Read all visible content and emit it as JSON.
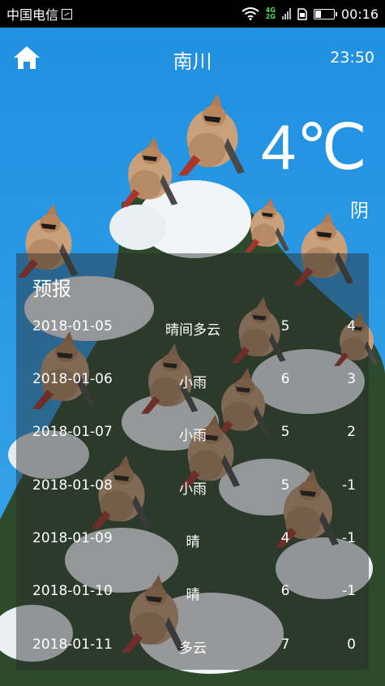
{
  "status_bar": {
    "carrier": "中国电信",
    "network_top": "4G",
    "network_bottom": "2G",
    "time": "00:16"
  },
  "header": {
    "city": "南川",
    "update_time": "23:50",
    "home_icon": "home-icon"
  },
  "current": {
    "temperature": "4℃",
    "condition": "阴"
  },
  "forecast": {
    "title": "预报",
    "days": [
      {
        "date": "2018-01-05",
        "weather": "晴间多云",
        "high": "5",
        "low": "4"
      },
      {
        "date": "2018-01-06",
        "weather": "小雨",
        "high": "6",
        "low": "3"
      },
      {
        "date": "2018-01-07",
        "weather": "小雨",
        "high": "5",
        "low": "2"
      },
      {
        "date": "2018-01-08",
        "weather": "小雨",
        "high": "5",
        "low": "-1"
      },
      {
        "date": "2018-01-09",
        "weather": "晴",
        "high": "4",
        "low": "-1"
      },
      {
        "date": "2018-01-10",
        "weather": "晴",
        "high": "6",
        "low": "-1"
      },
      {
        "date": "2018-01-11",
        "weather": "多云",
        "high": "7",
        "low": "0"
      }
    ]
  },
  "colors": {
    "sky": "#2a9ce6",
    "panel": "rgba(40,40,40,0.45)",
    "text": "#ffffff"
  }
}
